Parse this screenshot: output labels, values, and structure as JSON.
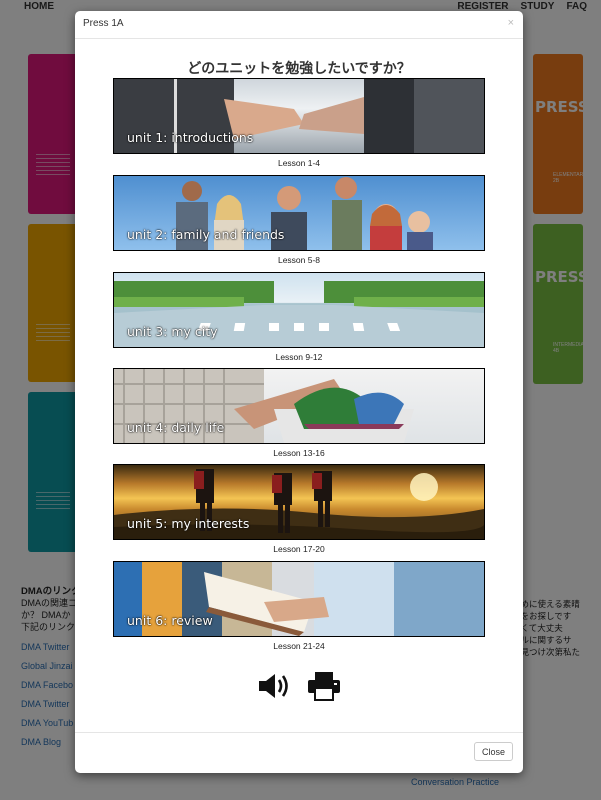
{
  "nav": {
    "home": "HOME",
    "register": "REGISTER",
    "study": "STUDY",
    "faq": "FAQ"
  },
  "background": {
    "books_left": [
      {
        "color": "#e0197d"
      },
      {
        "color": "#f2a900"
      },
      {
        "color": "#0f9aa5"
      }
    ],
    "books_right": [
      {
        "color": "#f07a1e",
        "title": "PRESS",
        "level": "ELEMENTARY 2B"
      },
      {
        "color": "#7ac143",
        "title": "PRESS",
        "level": "INTERMEDIATE 4B"
      }
    ],
    "links_heading": "DMAのリンク",
    "links_desc": [
      "DMAの関連コ",
      "か？ DMAか",
      "下記のリンク"
    ],
    "links": [
      "DMA Twitter",
      "Global Jinzai",
      "DMA Facebo",
      "DMA Twitter",
      "DMA YouTub",
      "DMA Blog"
    ],
    "right_text": [
      "ために使える素晴",
      "りをお探しです",
      "なくて大丈夫",
      "キルに関するサ",
      "を見つけ次第私た"
    ],
    "bottom_link": "Conversation Practice"
  },
  "modal": {
    "title": "Press 1A",
    "close_x": "×",
    "question": "どのユニットを勉強したいですか？",
    "units": [
      {
        "label": "unit 1: introductions",
        "lessons": "Lesson 1-4"
      },
      {
        "label": "unit 2: family and friends",
        "lessons": "Lesson 5-8"
      },
      {
        "label": "unit 3: my city",
        "lessons": "Lesson 9-12"
      },
      {
        "label": "unit 4: daily life",
        "lessons": "Lesson 13-16"
      },
      {
        "label": "unit 5: my interests",
        "lessons": "Lesson 17-20"
      },
      {
        "label": "unit 6: review",
        "lessons": "Lesson 21-24"
      }
    ],
    "icons": [
      "speaker-icon",
      "printer-icon"
    ],
    "close_button": "Close"
  }
}
